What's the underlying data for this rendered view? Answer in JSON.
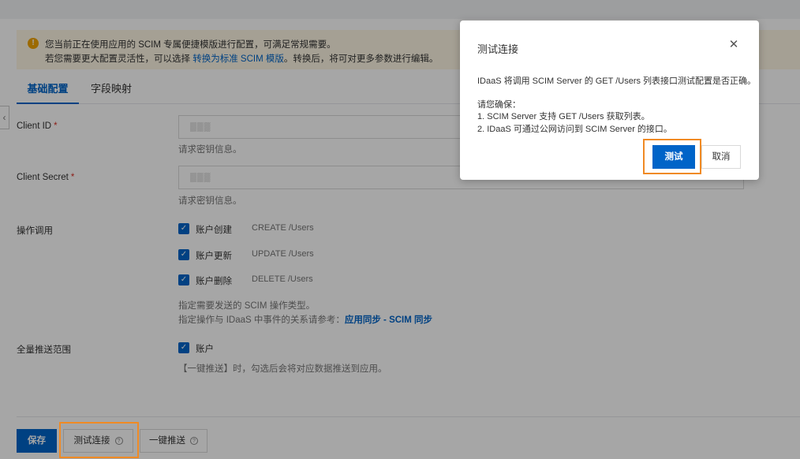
{
  "notice": {
    "line1": "您当前正在使用应用的 SCIM 专属便捷模版进行配置，可满足常规需要。",
    "line2_prefix": "若您需要更大配置灵活性，可以选择 ",
    "line2_link": "转换为标准 SCIM 模版",
    "line2_suffix": "。转换后，将可对更多参数进行编辑。"
  },
  "tabs": [
    {
      "label": "基础配置",
      "active": true
    },
    {
      "label": "字段映射",
      "active": false
    }
  ],
  "form": {
    "client_id": {
      "label": "Client ID",
      "required_mark": "*",
      "value": "▒▒▒",
      "hint": "请求密钥信息。"
    },
    "client_secret": {
      "label": "Client Secret",
      "required_mark": "*",
      "value": "▒▒▒",
      "hint": "请求密钥信息。"
    },
    "operations": {
      "label": "操作调用",
      "items": [
        {
          "label": "账户创建",
          "op": "CREATE /Users",
          "checked": true
        },
        {
          "label": "账户更新",
          "op": "UPDATE /Users",
          "checked": true
        },
        {
          "label": "账户删除",
          "op": "DELETE /Users",
          "checked": true
        }
      ],
      "hint1": "指定需要发送的 SCIM 操作类型。",
      "hint2_prefix": "指定操作与 IDaaS 中事件的关系请参考：",
      "hint2_link": "应用同步 - SCIM 同步"
    },
    "push_scope": {
      "label": "全量推送范围",
      "item": {
        "label": "账户",
        "checked": true
      },
      "hint": "【一键推送】时，勾选后会将对应数据推送到应用。"
    }
  },
  "footer": {
    "save_label": "保存",
    "test_label": "测试连接",
    "push_label": "一键推送"
  },
  "dialog": {
    "title": "测试连接",
    "desc": "IDaaS 将调用 SCIM Server 的 GET /Users 列表接口测试配置是否正确。",
    "ensure_label": "请您确保：",
    "ensure_1": "1. SCIM Server 支持 GET /Users 获取列表。",
    "ensure_2": "2. IDaaS 可通过公网访问到 SCIM Server 的接口。",
    "test_label": "测试",
    "cancel_label": "取消"
  },
  "icons": {
    "warning": "warning-circle-icon",
    "close": "close-icon",
    "check": "checkmark-icon",
    "help": "help-circle-icon",
    "chevron": "chevron-left-icon"
  },
  "colors": {
    "primary": "#0064c8",
    "highlight": "#f08a24",
    "notice_bg": "#fdf6e3",
    "warning": "#f0a400",
    "required": "#d93026"
  }
}
